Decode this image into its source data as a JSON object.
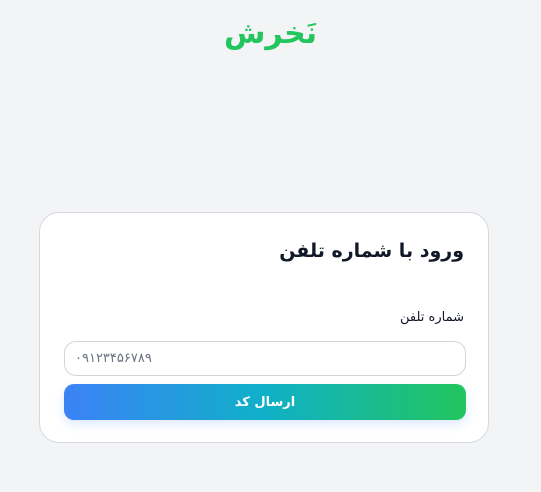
{
  "brand": {
    "logo_text": "نَخرش",
    "color": "#22c55e"
  },
  "login_card": {
    "title": "ورود با شماره تلفن",
    "phone_label": "شماره تلفن",
    "phone_input": {
      "value": "",
      "placeholder": "۰۹۱۲۳۴۵۶۷۸۹"
    },
    "submit_label": "ارسال کد",
    "submit_gradient": [
      "#3b82f6",
      "#22c55e"
    ]
  }
}
